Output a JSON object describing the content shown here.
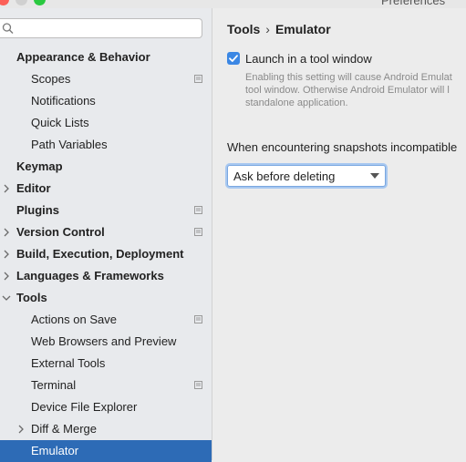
{
  "window": {
    "title": "Preferences"
  },
  "search": {
    "placeholder": "",
    "value": ""
  },
  "tree": [
    {
      "label": "Appearance & Behavior",
      "level": 0,
      "bold": true,
      "arrow": "none",
      "project": false,
      "name": "appearance-behavior"
    },
    {
      "label": "Scopes",
      "level": 1,
      "bold": false,
      "arrow": "none",
      "project": true,
      "name": "scopes"
    },
    {
      "label": "Notifications",
      "level": 1,
      "bold": false,
      "arrow": "none",
      "project": false,
      "name": "notifications"
    },
    {
      "label": "Quick Lists",
      "level": 1,
      "bold": false,
      "arrow": "none",
      "project": false,
      "name": "quick-lists"
    },
    {
      "label": "Path Variables",
      "level": 1,
      "bold": false,
      "arrow": "none",
      "project": false,
      "name": "path-variables"
    },
    {
      "label": "Keymap",
      "level": 0,
      "bold": true,
      "arrow": "none",
      "project": false,
      "name": "keymap"
    },
    {
      "label": "Editor",
      "level": 0,
      "bold": true,
      "arrow": "right",
      "project": false,
      "name": "editor"
    },
    {
      "label": "Plugins",
      "level": 0,
      "bold": true,
      "arrow": "none",
      "project": true,
      "name": "plugins"
    },
    {
      "label": "Version Control",
      "level": 0,
      "bold": true,
      "arrow": "right",
      "project": true,
      "name": "version-control"
    },
    {
      "label": "Build, Execution, Deployment",
      "level": 0,
      "bold": true,
      "arrow": "right",
      "project": false,
      "name": "build-execution-deployment"
    },
    {
      "label": "Languages & Frameworks",
      "level": 0,
      "bold": true,
      "arrow": "right",
      "project": false,
      "name": "languages-frameworks"
    },
    {
      "label": "Tools",
      "level": 0,
      "bold": true,
      "arrow": "down",
      "project": false,
      "name": "tools"
    },
    {
      "label": "Actions on Save",
      "level": 1,
      "bold": false,
      "arrow": "none",
      "project": true,
      "name": "actions-on-save"
    },
    {
      "label": "Web Browsers and Preview",
      "level": 1,
      "bold": false,
      "arrow": "none",
      "project": false,
      "name": "web-browsers-preview"
    },
    {
      "label": "External Tools",
      "level": 1,
      "bold": false,
      "arrow": "none",
      "project": false,
      "name": "external-tools"
    },
    {
      "label": "Terminal",
      "level": 1,
      "bold": false,
      "arrow": "none",
      "project": true,
      "name": "terminal"
    },
    {
      "label": "Device File Explorer",
      "level": 1,
      "bold": false,
      "arrow": "none",
      "project": false,
      "name": "device-file-explorer"
    },
    {
      "label": "Diff & Merge",
      "level": 1,
      "bold": false,
      "arrow": "right",
      "project": false,
      "name": "diff-merge"
    },
    {
      "label": "Emulator",
      "level": 1,
      "bold": false,
      "arrow": "none",
      "project": false,
      "name": "emulator",
      "selected": true
    }
  ],
  "breadcrumb": {
    "parent": "Tools",
    "separator": "›",
    "current": "Emulator"
  },
  "launch_option": {
    "label": "Launch in a tool window",
    "checked": true,
    "help_lines": [
      "Enabling this setting will cause Android Emulat",
      "tool window. Otherwise Android Emulator will l",
      "standalone application."
    ]
  },
  "snapshots": {
    "question": "When encountering snapshots incompatible",
    "selected_option": "Ask before deleting"
  },
  "colors": {
    "selection": "#2d6bb6",
    "checkbox": "#3b87e4",
    "sidebar_bg": "#e8eaed",
    "panel_bg": "#ececec"
  }
}
